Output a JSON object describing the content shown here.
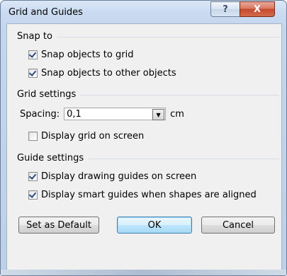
{
  "window": {
    "title": "Grid and Guides",
    "help_glyph": "?",
    "close_glyph": "X"
  },
  "snap": {
    "heading": "Snap to",
    "objects_to_grid": {
      "label": "Snap objects to grid",
      "checked": true
    },
    "objects_to_objects": {
      "label": "Snap objects to other objects",
      "checked": true
    }
  },
  "grid": {
    "heading": "Grid settings",
    "spacing_label": "Spacing:",
    "spacing_value": "0,1",
    "spacing_unit": "cm",
    "display_grid": {
      "label": "Display grid on screen",
      "checked": false
    }
  },
  "guides": {
    "heading": "Guide settings",
    "drawing_guides": {
      "label": "Display drawing guides on screen",
      "checked": true
    },
    "smart_guides": {
      "label": "Display smart guides when shapes are aligned",
      "checked": true
    }
  },
  "buttons": {
    "set_default": "Set as Default",
    "ok": "OK",
    "cancel": "Cancel"
  }
}
